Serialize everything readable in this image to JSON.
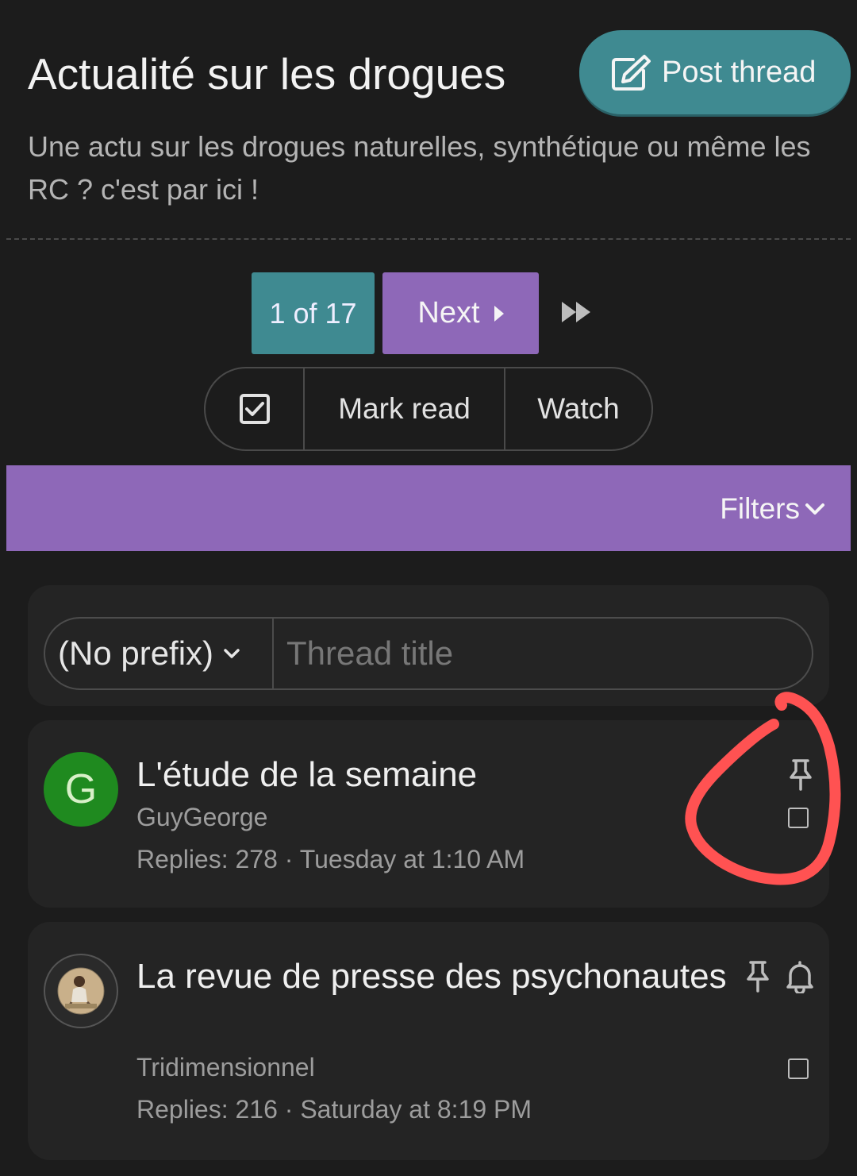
{
  "header": {
    "title": "Actualité sur les drogues",
    "post_button_label": "Post thread",
    "description": "Une actu sur les drogues naturelles, synthétique ou même les RC ? c'est par ici !"
  },
  "pagination": {
    "current": "1 of 17",
    "next_label": "Next"
  },
  "actions": {
    "mark_read": "Mark read",
    "watch": "Watch"
  },
  "filters": {
    "label": "Filters"
  },
  "quick_thread": {
    "prefix": "(No prefix)",
    "title_placeholder": "Thread title"
  },
  "threads": [
    {
      "avatar_letter": "G",
      "title": "L'étude de la semaine",
      "author": "GuyGeorge",
      "replies": "Replies: 278",
      "date": "Tuesday at 1:10 AM"
    },
    {
      "title": "La revue de presse des psychonautes",
      "author": "Tridimensionnel",
      "replies": "Replies: 216",
      "date": "Saturday at 8:19 PM"
    }
  ],
  "colors": {
    "background": "#1c1c1c",
    "teal": "#3f8a91",
    "purple": "#8e68b8",
    "card": "#242424",
    "annotation_red": "#ff5252"
  },
  "icons": [
    "edit-icon",
    "caret-right-icon",
    "fast-forward-icon",
    "checkbox-check-icon",
    "chevron-down-icon",
    "pin-icon",
    "bell-icon",
    "checkbox-icon"
  ]
}
